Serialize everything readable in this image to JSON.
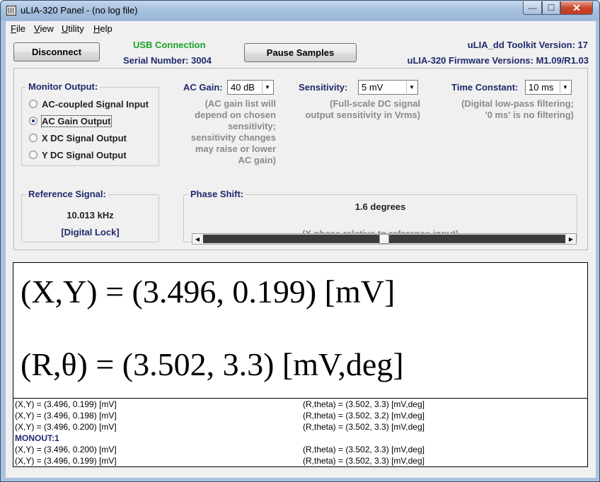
{
  "window": {
    "title": "uLIA-320 Panel - (no log file)",
    "min_glyph": "—",
    "max_glyph": "☐",
    "close_glyph": "✕"
  },
  "menu": [
    {
      "underline": "F",
      "rest": "ile"
    },
    {
      "underline": "V",
      "rest": "iew"
    },
    {
      "underline": "U",
      "rest": "tility"
    },
    {
      "underline": "H",
      "rest": "elp"
    }
  ],
  "header": {
    "disconnect_label": "Disconnect",
    "usb_status": "USB Connection",
    "serial": "Serial Number: 3004",
    "pause_label": "Pause Samples",
    "toolkit_version": "uLIA_dd Toolkit Version: 17",
    "firmware_versions": "uLIA-320 Firmware Versions: M1.09/R1.03"
  },
  "monitor": {
    "label": "Monitor Output:",
    "options": [
      {
        "label": "AC-coupled Signal Input",
        "selected": false
      },
      {
        "label": "AC Gain Output",
        "selected": true
      },
      {
        "label": "X DC Signal Output",
        "selected": false
      },
      {
        "label": "Y DC Signal Output",
        "selected": false
      }
    ]
  },
  "ac_gain": {
    "label": "AC Gain:",
    "value": "40 dB",
    "note": [
      "(AC gain list will",
      "depend on chosen",
      "sensitivity;",
      "sensitivity changes",
      "may raise or lower",
      "AC gain)"
    ]
  },
  "sensitivity": {
    "label": "Sensitivity:",
    "value": "5 mV",
    "note": [
      "(Full-scale DC signal",
      "output sensitivity in Vrms)"
    ]
  },
  "time_constant": {
    "label": "Time Constant:",
    "value": "10 ms",
    "note": [
      "(Digital low-pass filtering;",
      "'0 ms' is no filtering)"
    ]
  },
  "reference": {
    "label": "Reference Signal:",
    "frequency": "10.013 kHz",
    "lock": "[Digital Lock]"
  },
  "phase": {
    "label": "Phase Shift:",
    "value_text": "1.6 degrees",
    "slider_fraction": 0.5,
    "note": "(X phase relative to reference input)"
  },
  "readout": {
    "xy": "(X,Y) = (3.496, 0.199) [mV]",
    "rtheta": "(R,θ) = (3.502, 3.3) [mV,deg]"
  },
  "log": [
    {
      "left": "(X,Y) = (3.496, 0.199) [mV]",
      "right": "(R,theta) = (3.502, 3.3) [mV,deg]"
    },
    {
      "left": "(X,Y) = (3.496, 0.198) [mV]",
      "right": "(R,theta) = (3.502, 3.2) [mV,deg]"
    },
    {
      "left": "(X,Y) = (3.496, 0.200) [mV]",
      "right": "(R,theta) = (3.502, 3.3) [mV,deg]"
    },
    {
      "left": "MONOUT:1",
      "right": "",
      "note": true
    },
    {
      "left": "(X,Y) = (3.496, 0.200) [mV]",
      "right": "(R,theta) = (3.502, 3.3) [mV,deg]"
    },
    {
      "left": "(X,Y) = (3.496, 0.199) [mV]",
      "right": "(R,theta) = (3.502, 3.3) [mV,deg]"
    }
  ]
}
